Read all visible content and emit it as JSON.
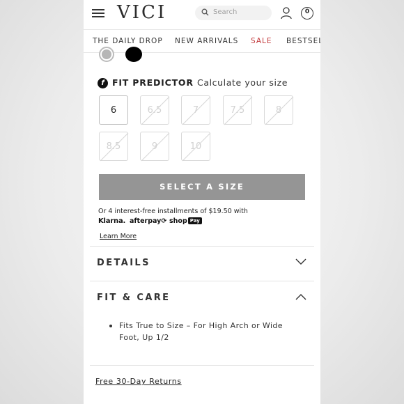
{
  "header": {
    "logo": "VICI",
    "search_placeholder": "Search",
    "cart_count": "0"
  },
  "nav": {
    "items": [
      "THE DAILY DROP",
      "NEW ARRIVALS",
      "SALE",
      "BESTSELLERS"
    ]
  },
  "swatches": [
    {
      "name": "silver",
      "color": "#b6b6b6",
      "selected": true
    },
    {
      "name": "black",
      "color": "#000000",
      "selected": false
    }
  ],
  "fit_predictor": {
    "title": "FIT PREDICTOR",
    "subtitle": "Calculate your size",
    "logo_glyph": "f"
  },
  "sizes": [
    {
      "label": "6",
      "available": true
    },
    {
      "label": "6.5",
      "available": false
    },
    {
      "label": "7",
      "available": false
    },
    {
      "label": "7.5",
      "available": false
    },
    {
      "label": "8",
      "available": false
    },
    {
      "label": "8.5",
      "available": false
    },
    {
      "label": "9",
      "available": false
    },
    {
      "label": "10",
      "available": false
    }
  ],
  "select_button": "SELECT A SIZE",
  "payment": {
    "installments_text": "Or 4 interest-free installments of $19.50 with",
    "providers": {
      "klarna": "Klarna.",
      "afterpay": "afterpay⟳",
      "shop": "shop",
      "shop_pill": "Pay"
    },
    "learn_more": "Learn More"
  },
  "accordions": {
    "details": {
      "title": "DETAILS",
      "expanded": false
    },
    "fit_care": {
      "title": "FIT & CARE",
      "expanded": true,
      "items": [
        "Fits True to Size – For High Arch or Wide Foot, Up 1/2"
      ]
    }
  },
  "returns_link": "Free 30-Day Returns",
  "colors": {
    "sale": "#c2383a",
    "button_bg": "#959595",
    "page_bg": "#ffffff"
  }
}
